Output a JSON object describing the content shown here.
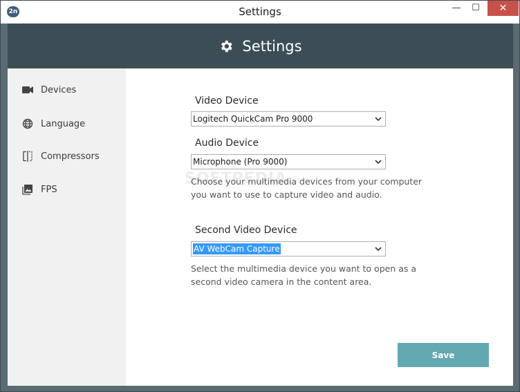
{
  "window": {
    "title": "Settings",
    "app_icon_label": "2n",
    "minimize_glyph": "—",
    "maximize_glyph": "☐",
    "close_glyph": "✕"
  },
  "header": {
    "title": "Settings",
    "icon": "gear-icon"
  },
  "sidebar": {
    "items": [
      {
        "label": "Devices",
        "icon": "video-camera-icon"
      },
      {
        "label": "Language",
        "icon": "globe-icon"
      },
      {
        "label": "Compressors",
        "icon": "compress-icon"
      },
      {
        "label": "FPS",
        "icon": "image-icon"
      }
    ]
  },
  "content": {
    "video_device": {
      "label": "Video Device",
      "value": "Logitech QuickCam Pro 9000"
    },
    "audio_device": {
      "label": "Audio Device",
      "value": "Microphone (Pro 9000)"
    },
    "devices_description": "Choose your multimedia devices from your computer you want to use to capture video and audio.",
    "second_video_device": {
      "label": "Second Video Device",
      "value": "AV WebCam Capture"
    },
    "second_description": "Select the multimedia device you want to open as a second video camera in the content area.",
    "save_label": "Save",
    "watermark": "SOFTPEDIA"
  },
  "colors": {
    "header_bg": "#3c4d56",
    "save_button": "#64a8b2",
    "close_button": "#c7524b",
    "selection": "#3399ff"
  }
}
